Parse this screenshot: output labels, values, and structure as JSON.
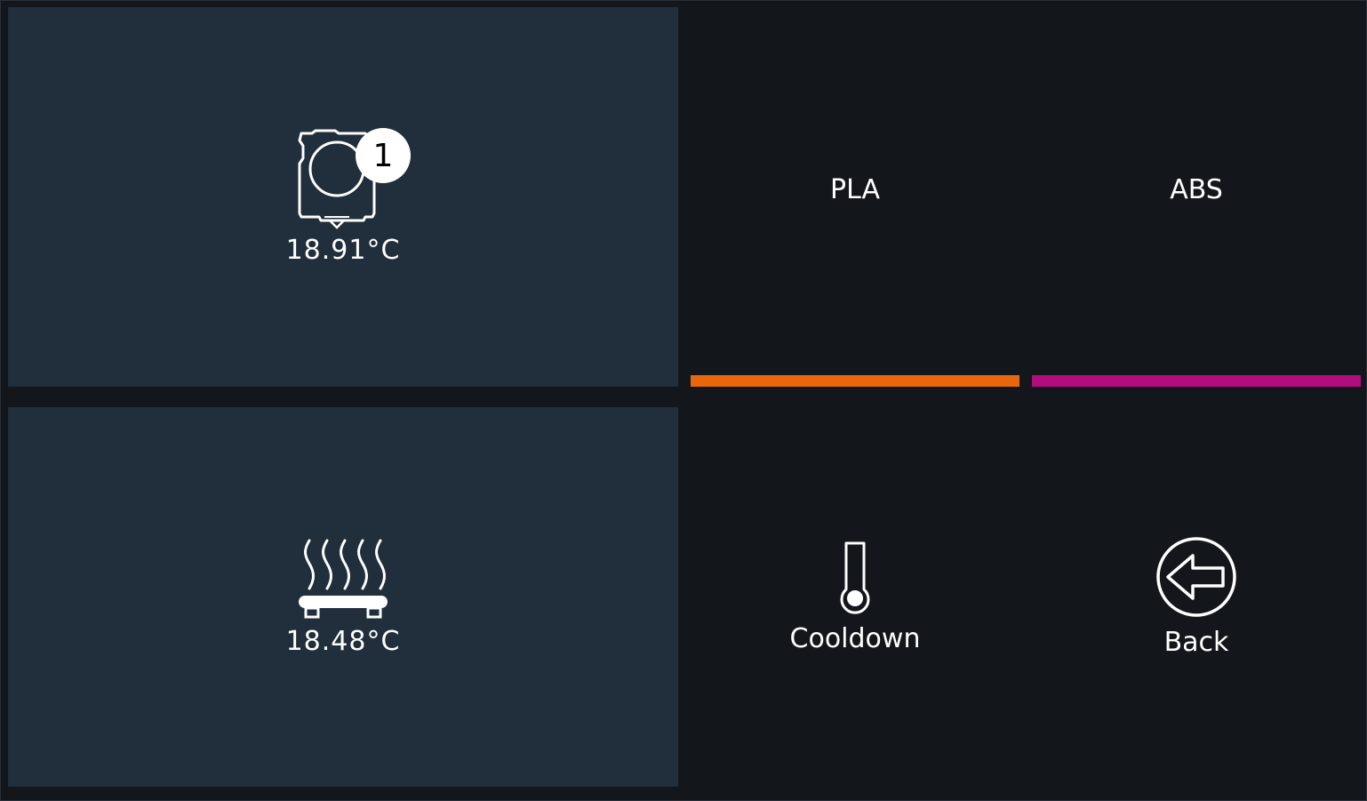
{
  "extruder": {
    "temperature": "18.91°C",
    "tool_number": "1",
    "icon": "extruder-icon"
  },
  "bed": {
    "temperature": "18.48°C",
    "icon": "heated-bed-icon"
  },
  "presets": [
    {
      "label": "PLA",
      "color": "#e8670a"
    },
    {
      "label": "ABS",
      "color": "#b10d7d"
    }
  ],
  "actions": {
    "cooldown_label": "Cooldown",
    "cooldown_icon": "thermometer-icon",
    "back_label": "Back",
    "back_icon": "back-arrow-icon"
  },
  "colors": {
    "background": "#13171b",
    "card": "#212e3b",
    "text": "#ffffff"
  }
}
